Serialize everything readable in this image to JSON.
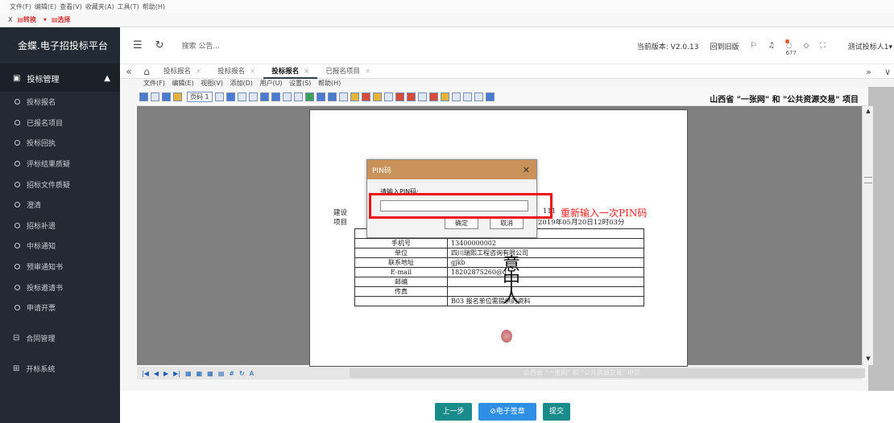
{
  "ie_menu": [
    "文件(F)",
    "编辑(E)",
    "查看(V)",
    "收藏夹(A)",
    "工具(T)",
    "帮助(H)"
  ],
  "ie_toolbar": {
    "close": "X",
    "convert": "转换",
    "select": "选择"
  },
  "sidebar": {
    "brand": "金蝶.电子招投标平台",
    "group": "投标管理",
    "items": [
      "投标报名",
      "已报名项目",
      "投标回执",
      "评标结果质疑",
      "招标文件质疑",
      "澄清",
      "招标补遗",
      "中标通知",
      "预审通知书",
      "投标邀请书",
      "申请开票"
    ],
    "sections": [
      "合同管理",
      "开标系统"
    ]
  },
  "topbar": {
    "search": "搜索 公告...",
    "version": "当前版本: V2.0.13",
    "back_version": "回到旧版",
    "badge_count": "677",
    "user": "测试投标人1"
  },
  "tabs": [
    {
      "label": "投标报名",
      "active": false
    },
    {
      "label": "投标报名",
      "active": false
    },
    {
      "label": "投标报名",
      "active": true
    },
    {
      "label": "已报名项目",
      "active": false
    }
  ],
  "embedded_menu": [
    "文件(F)",
    "编辑(E)",
    "视图(V)",
    "添加(D)",
    "用户(U)",
    "设置(S)",
    "帮助(H)"
  ],
  "doc": {
    "page_select": "页码 1",
    "title": "山西省 \"一张网\" 和 \"公共资源交易\" 项目",
    "line1_left": "建设",
    "line1_right": "111",
    "line2_left": "项目",
    "line2_right": "2019年05月20日12时03分",
    "table": [
      {
        "k": "",
        "v": ""
      },
      {
        "k": "手机号",
        "v": "13400000002"
      },
      {
        "k": "单位",
        "v": "四川瑞熙工程咨询有限公司"
      },
      {
        "k": "联系地址",
        "v": "gjkb"
      },
      {
        "k": "E-mail",
        "v": "18202875260@q"
      },
      {
        "k": "邮编",
        "v": ""
      },
      {
        "k": "传真",
        "v": ""
      },
      {
        "k": "",
        "v": "B03 报名单位需提供的资料"
      }
    ],
    "signature": "意中人",
    "watermark": "山西省 \"一张网\" 和 \"公共资源交易\" 项目"
  },
  "dialog": {
    "title": "PIN码",
    "prompt": "请输入PIN码:",
    "value": "",
    "ok": "确定",
    "cancel": "取消"
  },
  "annotation": "重新输入一次PIN码",
  "footer": {
    "prev": "上一步",
    "sign": "电子签章",
    "submit": "提交"
  }
}
